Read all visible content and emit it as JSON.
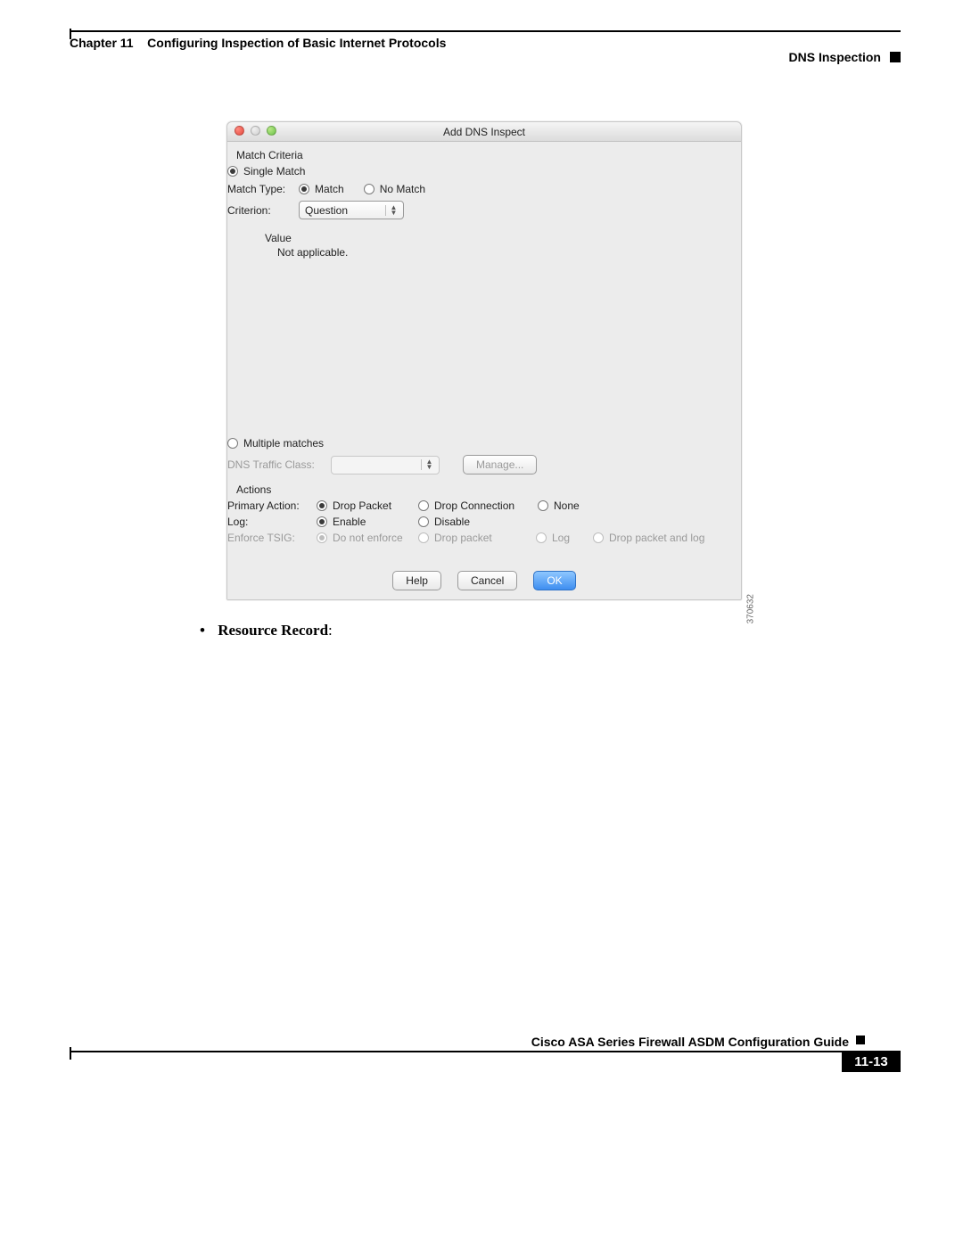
{
  "header": {
    "chapter_label": "Chapter 11",
    "chapter_title": "Configuring Inspection of Basic Internet Protocols",
    "section_title": "DNS Inspection"
  },
  "bullet": {
    "marker": "•",
    "text": "Resource Record",
    "suffix": ":"
  },
  "footer": {
    "guide_title": "Cisco ASA Series Firewall ASDM Configuration Guide",
    "page_number": "11-13"
  },
  "dialog": {
    "title": "Add DNS Inspect",
    "image_id": "370632",
    "match_criteria": {
      "heading": "Match Criteria",
      "single_match": {
        "label": "Single Match",
        "selected": true
      },
      "match_type": {
        "label": "Match Type:",
        "options": [
          {
            "label": "Match",
            "selected": true
          },
          {
            "label": "No Match",
            "selected": false
          }
        ]
      },
      "criterion": {
        "label": "Criterion:",
        "value": "Question"
      },
      "value_section": {
        "heading": "Value",
        "body": "Not applicable."
      },
      "multiple_matches": {
        "label": "Multiple matches",
        "selected": false
      },
      "traffic_class": {
        "label": "DNS Traffic Class:",
        "value": "",
        "manage_label": "Manage..."
      }
    },
    "actions": {
      "heading": "Actions",
      "primary_action": {
        "label": "Primary Action:",
        "options": [
          {
            "label": "Drop Packet",
            "selected": true
          },
          {
            "label": "Drop Connection",
            "selected": false
          },
          {
            "label": "None",
            "selected": false
          }
        ]
      },
      "log": {
        "label": "Log:",
        "options": [
          {
            "label": "Enable",
            "selected": true
          },
          {
            "label": "Disable",
            "selected": false
          }
        ]
      },
      "enforce_tsig": {
        "label": "Enforce TSIG:",
        "options": [
          {
            "label": "Do not enforce",
            "selected": true
          },
          {
            "label": "Drop packet",
            "selected": false
          },
          {
            "label": "Log",
            "selected": false
          },
          {
            "label": "Drop packet and log",
            "selected": false
          }
        ]
      }
    },
    "buttons": {
      "help": "Help",
      "cancel": "Cancel",
      "ok": "OK"
    }
  }
}
